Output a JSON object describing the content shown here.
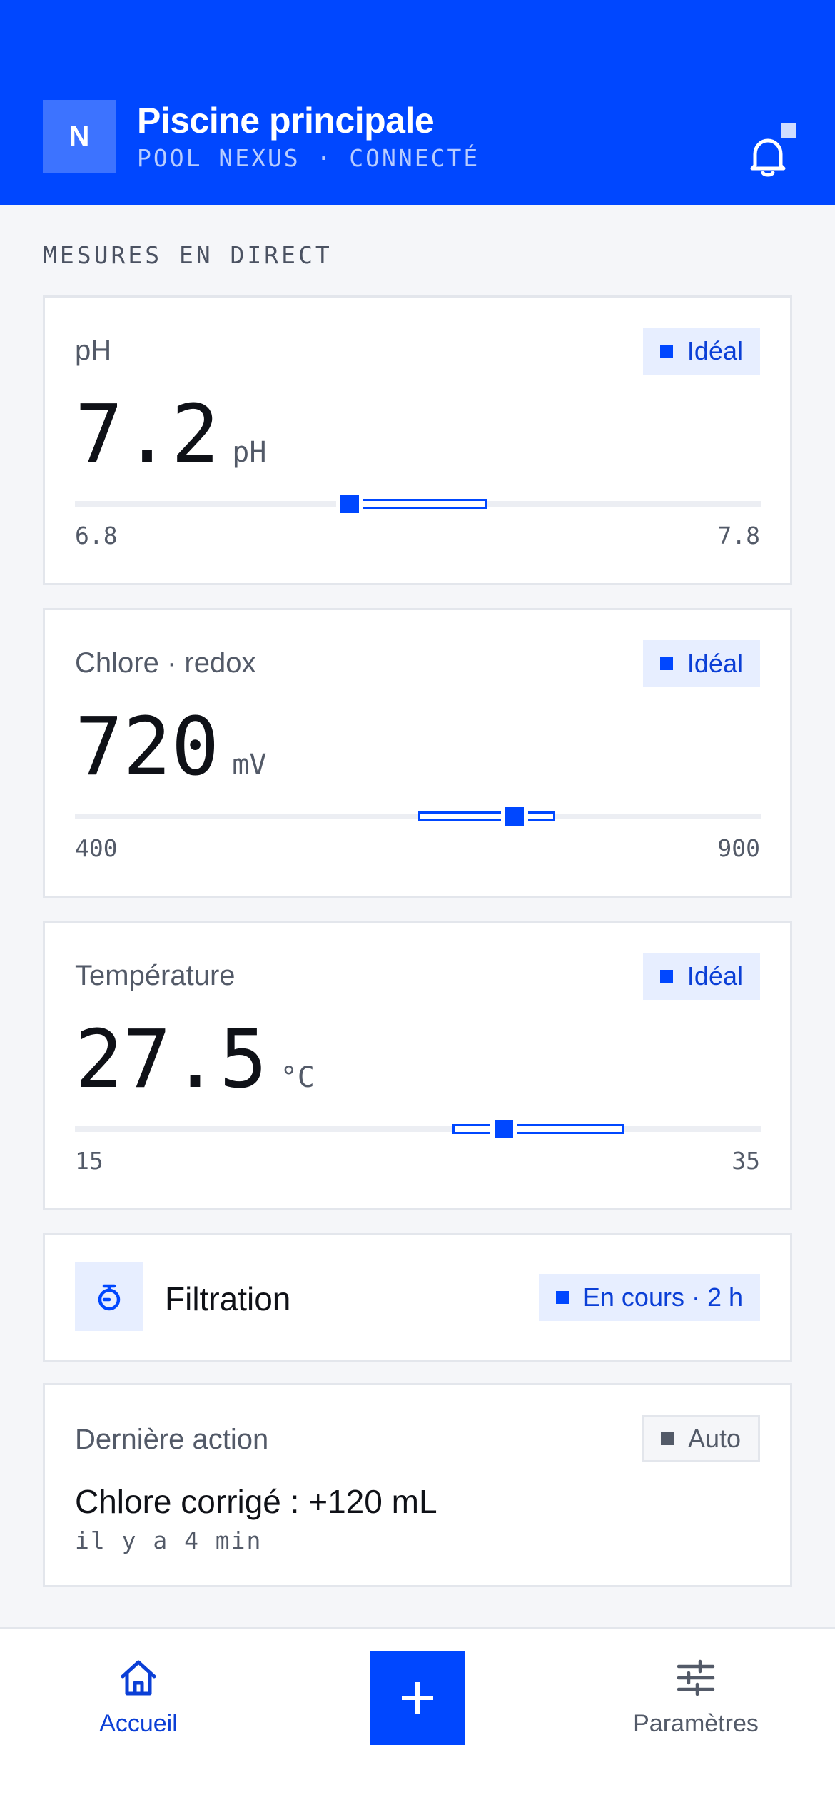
{
  "header": {
    "avatar_letter": "N",
    "title": "Piscine principale",
    "subtitle": "POOL NEXUS · CONNECTÉ"
  },
  "section": {
    "label": "MESURES EN DIRECT"
  },
  "metrics": [
    {
      "label": "pH",
      "status": "Idéal",
      "value": "7.2",
      "unit": "pH",
      "min": "6.8",
      "max": "7.8",
      "range": {
        "min": 6.8,
        "max": 7.8,
        "ideal_low": 7.2,
        "ideal_high": 7.4,
        "current": 7.2
      }
    },
    {
      "label": "Chlore · redox",
      "status": "Idéal",
      "value": "720",
      "unit": "mV",
      "min": "400",
      "max": "900",
      "range": {
        "min": 400,
        "max": 900,
        "ideal_low": 650,
        "ideal_high": 750,
        "current": 720
      }
    },
    {
      "label": "Température",
      "status": "Idéal",
      "value": "27.5",
      "unit": "°C",
      "min": "15",
      "max": "35",
      "range": {
        "min": 15,
        "max": 35,
        "ideal_low": 26,
        "ideal_high": 31,
        "current": 27.5
      }
    }
  ],
  "filtration": {
    "title": "Filtration",
    "status": "En cours · 2 h",
    "icon": "timer-icon"
  },
  "last_action": {
    "label": "Dernière action",
    "badge": "Auto",
    "text": "Chlore corrigé : +120 mL",
    "time": "il y a 4 min"
  },
  "nav": {
    "home_label": "Accueil",
    "settings_label": "Paramètres",
    "add_icon": "plus-icon"
  },
  "colors": {
    "accent": "#0047ff",
    "background": "#f5f6f9",
    "muted": "#535a68"
  }
}
